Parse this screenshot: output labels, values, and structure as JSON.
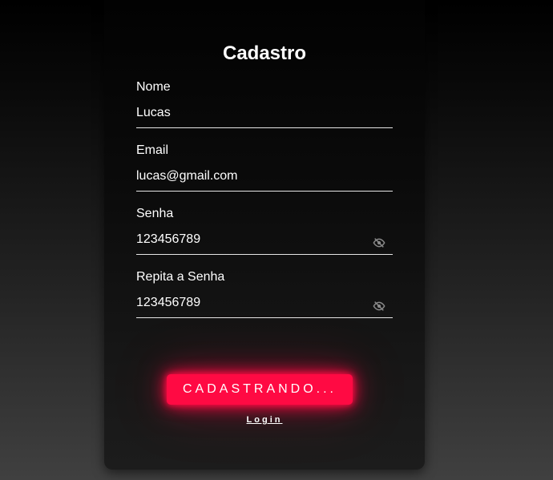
{
  "form": {
    "title": "Cadastro",
    "fields": [
      {
        "label": "Nome",
        "value": "Lucas",
        "type": "text"
      },
      {
        "label": "Email",
        "value": "lucas@gmail.com",
        "type": "email"
      },
      {
        "label": "Senha",
        "value": "123456789",
        "type": "text",
        "icon": "eye-off-icon"
      },
      {
        "label": "Repita a Senha",
        "value": "123456789",
        "type": "text",
        "icon": "eye-off-icon"
      }
    ],
    "submit_label": "CADASTRANDO...",
    "login_link": "Login"
  },
  "colors": {
    "accent": "#ff0a43",
    "icon": "#8a8a8a"
  }
}
